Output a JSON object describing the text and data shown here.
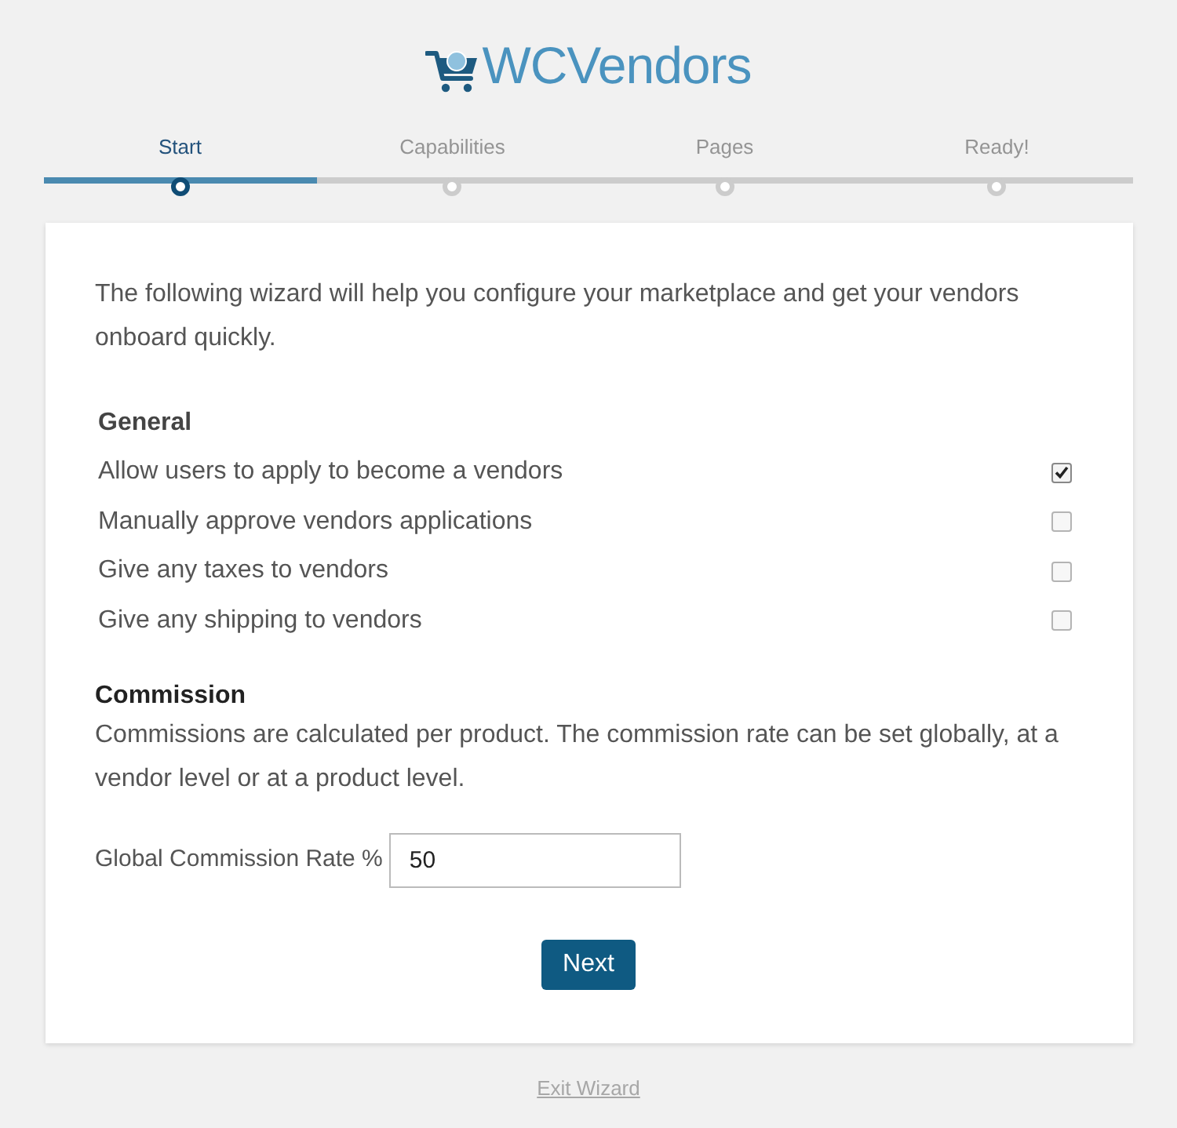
{
  "logo": {
    "text": "WCVendors"
  },
  "steps": [
    {
      "label": "Start",
      "selected": true
    },
    {
      "label": "Capabilities",
      "selected": false
    },
    {
      "label": "Pages",
      "selected": false
    },
    {
      "label": "Ready!",
      "selected": false
    }
  ],
  "progress": {
    "level": 0.25
  },
  "intro": "The following wizard will help you configure your marketplace and get your vendors onboard quickly.",
  "general": {
    "heading": "General",
    "options": [
      {
        "label": "Allow users to apply to become a vendors",
        "checked": true
      },
      {
        "label": "Manually approve vendors applications",
        "checked": false
      },
      {
        "label": "Give any taxes to vendors",
        "checked": false
      },
      {
        "label": "Give any shipping to vendors",
        "checked": false
      }
    ]
  },
  "commission": {
    "heading": "Commission",
    "description": "Commissions are calculated per product. The commission rate can be set globally, at a vendor level or at a product level.",
    "rate_label": "Global Commission Rate %",
    "rate_value": "50"
  },
  "next_button": "Next",
  "exit_link": "Exit Wizard"
}
